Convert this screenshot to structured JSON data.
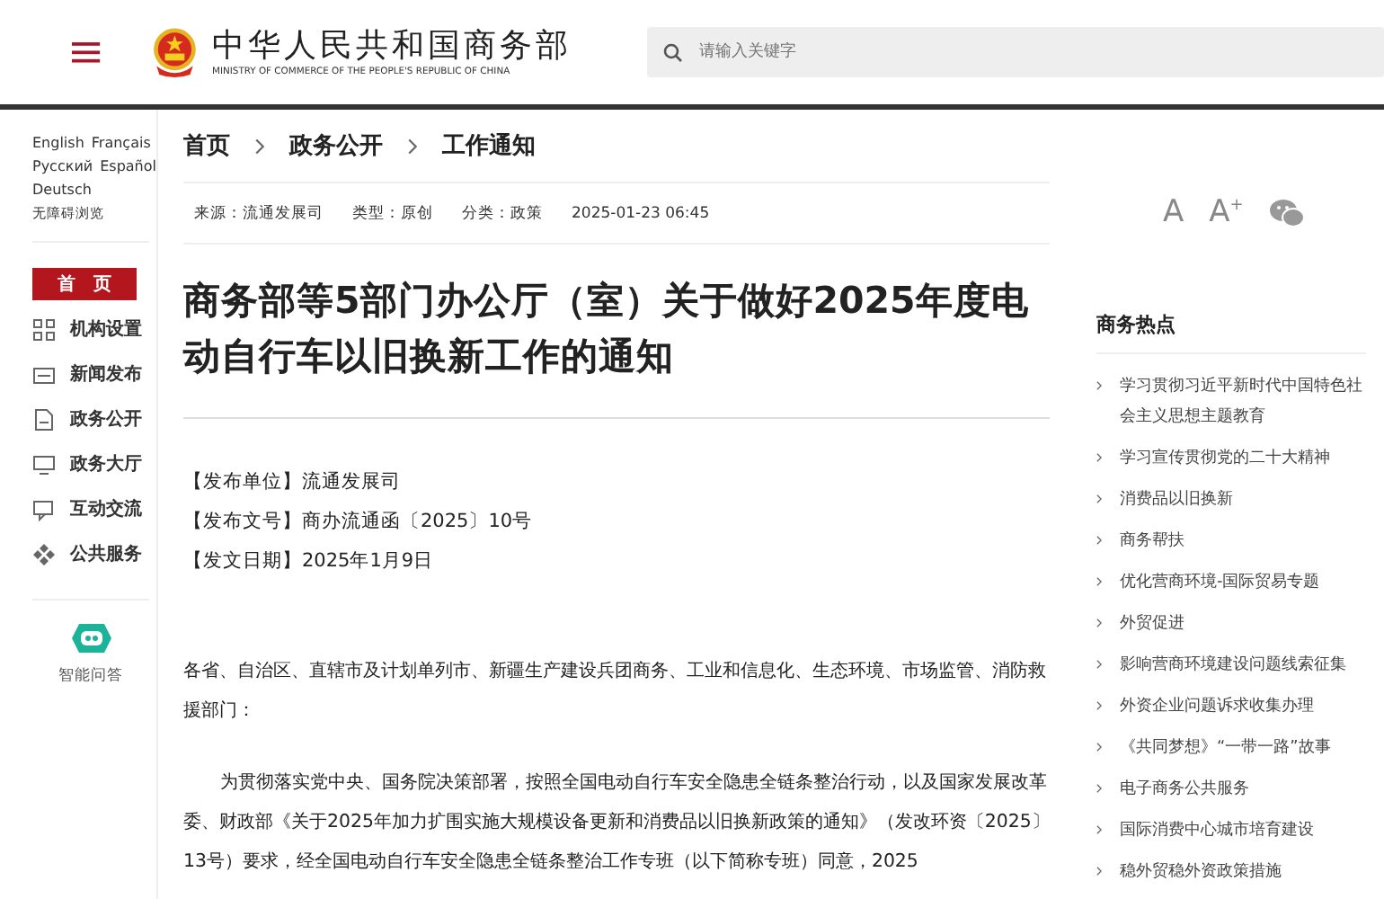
{
  "header": {
    "title": "中华人民共和国商务部",
    "subtitle": "MINISTRY OF COMMERCE OF THE PEOPLE'S REPUBLIC OF CHINA",
    "search": {
      "placeholder": "请输入关键字"
    }
  },
  "sidebar": {
    "languages": [
      [
        "English",
        "Français"
      ],
      [
        "Русский",
        "Español"
      ],
      [
        "Deutsch"
      ]
    ],
    "accessibility": "无障碍浏览",
    "items": [
      {
        "label": "首　页",
        "selected": true
      },
      {
        "label": "机构设置",
        "selected": false
      },
      {
        "label": "新闻发布",
        "selected": false
      },
      {
        "label": "政务公开",
        "selected": false
      },
      {
        "label": "政务大厅",
        "selected": false
      },
      {
        "label": "互动交流",
        "selected": false
      },
      {
        "label": "公共服务",
        "selected": false
      }
    ],
    "assistant": "智能问答"
  },
  "breadcrumb": [
    "首页",
    "政务公开",
    "工作通知"
  ],
  "meta": [
    "来源：流通发展司",
    "类型：原创",
    "分类：政策",
    "2025-01-23 06:45"
  ],
  "font_buttons": [
    "A",
    "A$^{+}$"
  ],
  "article": {
    "title": "商务部等5部门办公厅（室）关于做好2025年度电动自行车以旧换新工作的通知",
    "info": [
      "【发布单位】流通发展司",
      "【发布文号】商办流通函〔2025〕10号",
      "【发文日期】2025年1月9日"
    ],
    "paragraphs": [
      "各省、自治区、直辖市及计划单列市、新疆生产建设兵团商务、工业和信息化、生态环境、市场监管、消防救援部门：",
      "为贯彻落实党中央、国务院决策部署，按照全国电动自行车安全隐患全链条整治行动，以及国家发展改革委、财政部《关于2025年加力扩围实施大规模设备更新和消费品以旧换新政策的通知》（发改环资〔2025〕13号）要求，经全国电动自行车安全隐患全链条整治工作专班（以下简称专班）同意，2025"
    ]
  },
  "hot": {
    "title": "商务热点",
    "items": [
      "学习贯彻习近平新时代中国特色社会主义思想主题教育",
      "学习宣传贯彻党的二十大精神",
      "消费品以旧换新",
      "商务帮扶",
      "优化营商环境-国际贸易专题",
      "外贸促进",
      "影响营商环境建设问题线索征集",
      "外资企业问题诉求收集办理",
      "《共同梦想》“一带一路”故事",
      "电子商务公共服务",
      "国际消费中心城市培育建设",
      "稳外贸稳外资政策措施"
    ]
  }
}
